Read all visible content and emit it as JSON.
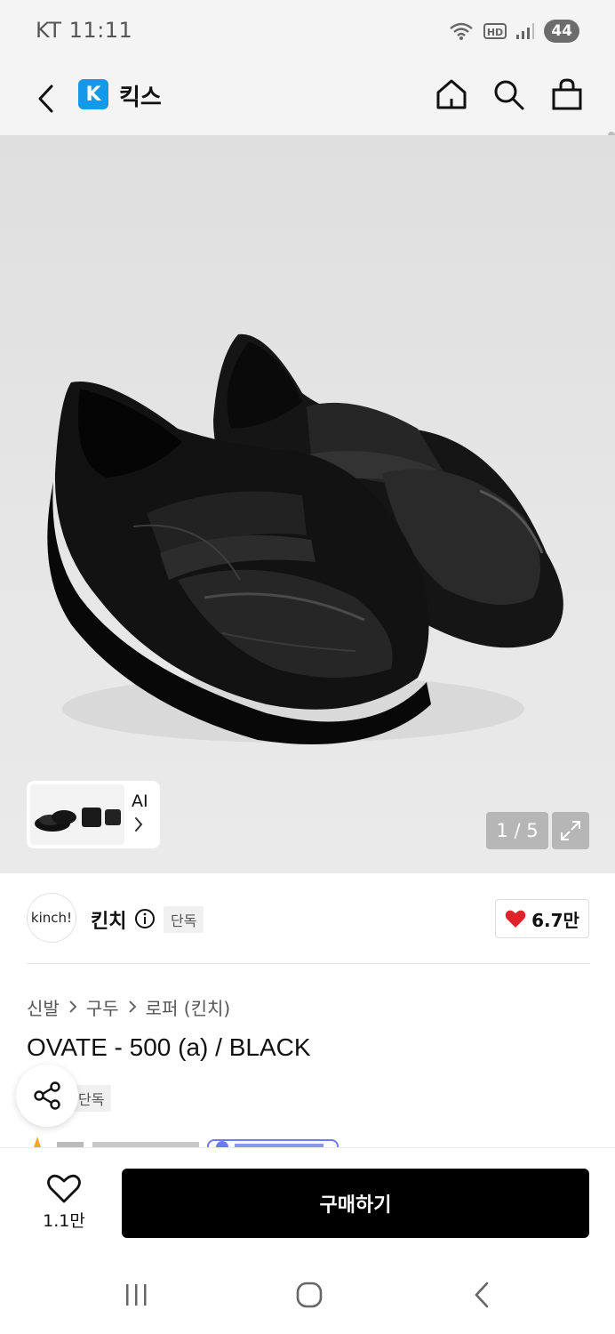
{
  "status_bar": {
    "carrier_time": "KT 11:11",
    "battery": "44"
  },
  "header": {
    "logo_letter": "K",
    "app_name": "킥스"
  },
  "gallery": {
    "thumbnail_label": "AI",
    "page_indicator": "1 / 5"
  },
  "brand": {
    "logo_text": "kinch!",
    "name": "킨치",
    "badge": "단독",
    "like_count": "6.7만"
  },
  "product": {
    "breadcrumb": [
      "신발",
      "구두",
      "로퍼 (킨치)"
    ],
    "title": "OVATE - 500 (a) / BLACK",
    "badge": "단독"
  },
  "action_bar": {
    "wish_count": "1.1만",
    "buy_label": "구매하기"
  },
  "colors": {
    "accent_blue": "#1499e8",
    "heart_red": "#e0222a",
    "buy_black": "#000000"
  }
}
